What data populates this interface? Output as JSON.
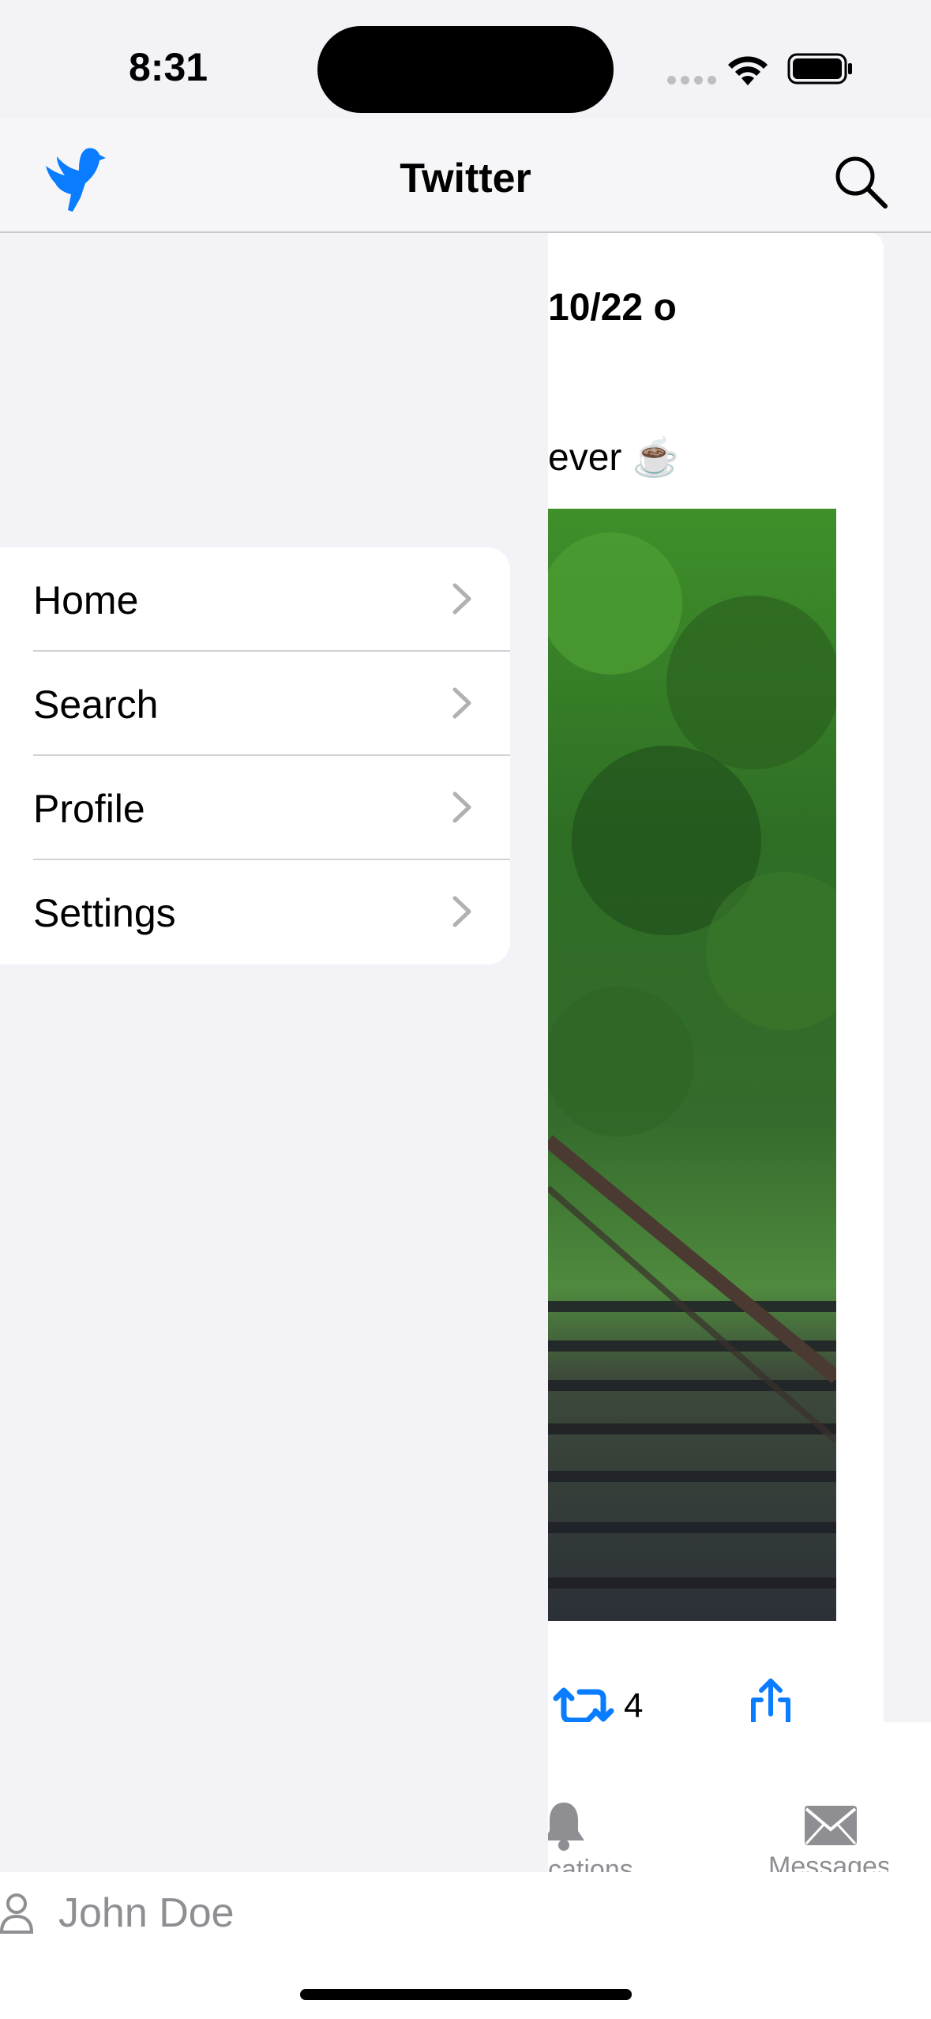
{
  "status_bar": {
    "time": "8:31"
  },
  "nav": {
    "title": "Twitter"
  },
  "menu": {
    "items": [
      {
        "label": "Home"
      },
      {
        "label": "Search"
      },
      {
        "label": "Profile"
      },
      {
        "label": "Settings"
      }
    ]
  },
  "feed": {
    "header_text": "10/22 o",
    "body_text": "ever ☕",
    "retweet_count": "4"
  },
  "tabbar": {
    "notifications_label": "cations",
    "messages_label": "Messages"
  },
  "user": {
    "name": "John Doe"
  },
  "colors": {
    "accent": "#0a7cff",
    "secondary_text": "#8e8e93",
    "background": "#f2f2f7"
  }
}
